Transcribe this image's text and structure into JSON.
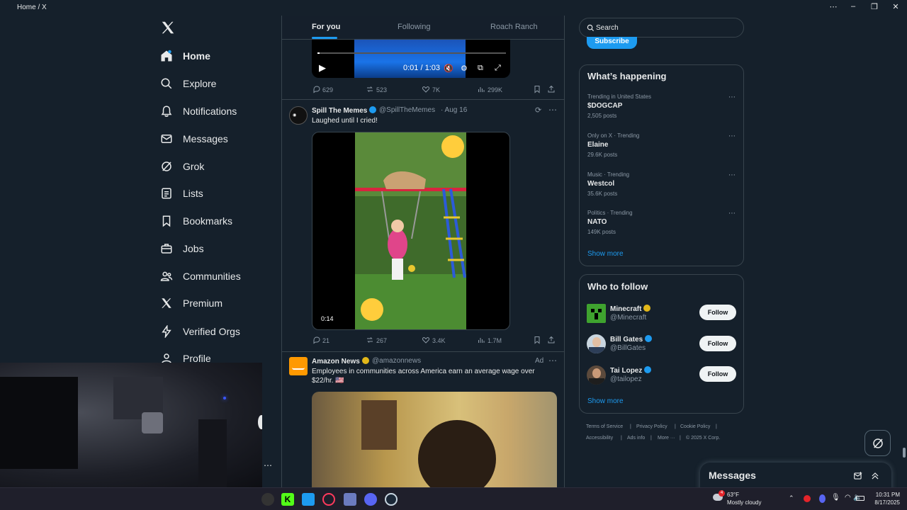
{
  "window": {
    "title": "Home / X"
  },
  "nav": {
    "items": [
      {
        "label": "Home",
        "icon": "home-icon"
      },
      {
        "label": "Explore",
        "icon": "search-icon"
      },
      {
        "label": "Notifications",
        "icon": "bell-icon"
      },
      {
        "label": "Messages",
        "icon": "mail-icon"
      },
      {
        "label": "Grok",
        "icon": "grok-icon"
      },
      {
        "label": "Lists",
        "icon": "list-icon"
      },
      {
        "label": "Bookmarks",
        "icon": "bookmark-icon"
      },
      {
        "label": "Jobs",
        "icon": "briefcase-icon"
      },
      {
        "label": "Communities",
        "icon": "people-icon"
      },
      {
        "label": "Premium",
        "icon": "x-icon"
      },
      {
        "label": "Verified Orgs",
        "icon": "lightning-icon"
      },
      {
        "label": "Profile",
        "icon": "person-icon"
      }
    ]
  },
  "tabs": [
    "For you",
    "Following",
    "Roach Ranch"
  ],
  "post1": {
    "video_time": "0:01 / 1:03",
    "replies": "629",
    "reposts": "523",
    "likes": "7K",
    "views": "299K"
  },
  "post2": {
    "name": "Spill The Memes",
    "handle": "@SpillTheMemes",
    "date": "· Aug 16",
    "text": "Laughed until I cried!",
    "video_time": "0:14",
    "replies": "21",
    "reposts": "267",
    "likes": "3.4K",
    "views": "1.7M"
  },
  "post3": {
    "name": "Amazon News",
    "handle": "@amazonnews",
    "ad_label": "Ad",
    "text": "Employees in communities across America earn an average wage over $22/hr. 🇺🇸"
  },
  "search": {
    "placeholder": "Search"
  },
  "subscribe_label": "Subscribe",
  "happening": {
    "title": "What’s happening",
    "trends": [
      {
        "meta": "Trending in United States",
        "name": "$DOGCAP",
        "count": "2,505 posts"
      },
      {
        "meta": "Only on X · Trending",
        "name": "Elaine",
        "count": "29.6K posts"
      },
      {
        "meta": "Music · Trending",
        "name": "Westcol",
        "count": "35.6K posts"
      },
      {
        "meta": "Politics · Trending",
        "name": "NATO",
        "count": "149K posts"
      }
    ],
    "show_more": "Show more"
  },
  "who_to_follow": {
    "title": "Who to follow",
    "accounts": [
      {
        "name": "Minecraft",
        "handle": "@Minecraft",
        "button": "Follow"
      },
      {
        "name": "Bill Gates",
        "handle": "@BillGates",
        "button": "Follow"
      },
      {
        "name": "Tai Lopez",
        "handle": "@tailopez",
        "button": "Follow"
      }
    ],
    "show_more": "Show more"
  },
  "footer": {
    "row1": [
      "Terms of Service",
      "Privacy Policy",
      "Cookie Policy"
    ],
    "row2": [
      "Accessibility",
      "Ads info",
      "More ···",
      "© 2025 X Corp."
    ]
  },
  "messages_drawer": {
    "label": "Messages"
  },
  "taskbar": {
    "weather_temp": "63°F",
    "weather_desc": "Mostly cloudy",
    "weather_badge": "4",
    "time": "10:31 PM",
    "date": "8/17/2025"
  },
  "colors": {
    "accent": "#1d9bf0",
    "background": "#15202b",
    "border": "#38444d",
    "muted": "#8b98a5"
  }
}
